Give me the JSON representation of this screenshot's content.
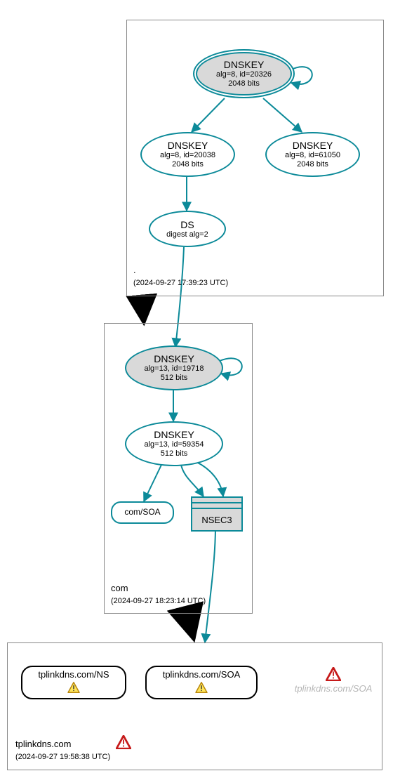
{
  "zones": {
    "root": {
      "name": ".",
      "timestamp": "(2024-09-27 17:39:23 UTC)"
    },
    "com": {
      "name": "com",
      "timestamp": "(2024-09-27 18:23:14 UTC)"
    },
    "tplinkdns": {
      "name": "tplinkdns.com",
      "timestamp": "(2024-09-27 19:58:38 UTC)"
    }
  },
  "nodes": {
    "root_ksk": {
      "title": "DNSKEY",
      "line2": "alg=8, id=20326",
      "line3": "2048 bits"
    },
    "root_zsk1": {
      "title": "DNSKEY",
      "line2": "alg=8, id=20038",
      "line3": "2048 bits"
    },
    "root_zsk2": {
      "title": "DNSKEY",
      "line2": "alg=8, id=61050",
      "line3": "2048 bits"
    },
    "root_ds": {
      "title": "DS",
      "line2": "digest alg=2"
    },
    "com_ksk": {
      "title": "DNSKEY",
      "line2": "alg=13, id=19718",
      "line3": "512 bits"
    },
    "com_zsk": {
      "title": "DNSKEY",
      "line2": "alg=13, id=59354",
      "line3": "512 bits"
    },
    "com_soa": {
      "label": "com/SOA"
    },
    "nsec3": {
      "label": "NSEC3"
    },
    "tpl_ns": {
      "label": "tplinkdns.com/NS"
    },
    "tpl_soa": {
      "label": "tplinkdns.com/SOA"
    },
    "tpl_soa_faded": {
      "label": "tplinkdns.com/SOA"
    }
  },
  "icons": {
    "warning_yellow": "⚠",
    "warning_red": "⚠"
  }
}
